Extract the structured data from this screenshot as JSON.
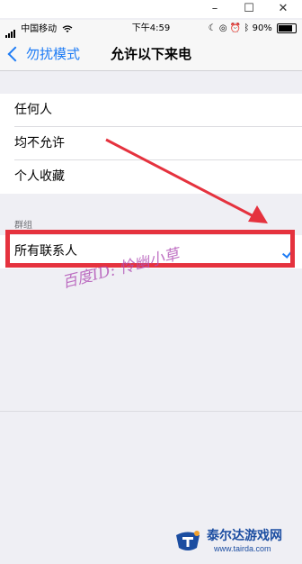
{
  "window": {
    "minimize_label": "–",
    "maximize_label": "☐",
    "close_label": "✕"
  },
  "status_bar": {
    "carrier": "中国移动",
    "time": "下午4:59",
    "battery": "90%"
  },
  "nav": {
    "back_label": "勿扰模式",
    "title": "允许以下来电"
  },
  "options": [
    {
      "label": "任何人"
    },
    {
      "label": "均不允许"
    },
    {
      "label": "个人收藏"
    }
  ],
  "groups_section": {
    "header": "群组",
    "items": [
      {
        "label": "所有联系人",
        "selected": true
      }
    ]
  },
  "watermark": {
    "text": "百度ID: 怜幽小草"
  },
  "site_logo": {
    "name": "泰尔达游戏网",
    "url": "www.tairda.com"
  },
  "colors": {
    "accent": "#1e7cf5",
    "annotation": "#e5323e",
    "background": "#efeff4"
  }
}
